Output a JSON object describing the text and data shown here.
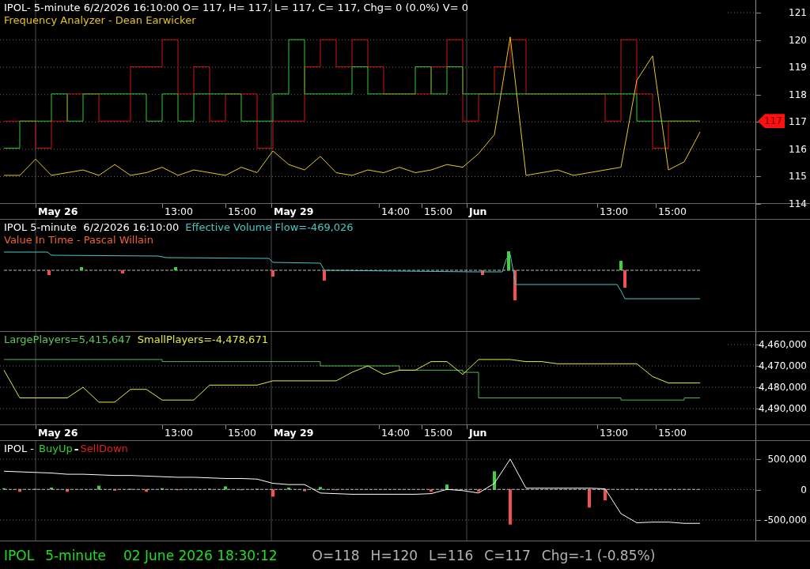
{
  "panels": [
    {
      "kind": "price",
      "legend_lines": [
        [
          {
            "text": "IPOL- 5-minute 6/2/2026 16:10:00 O= 117, H= 117, L= 117, C= 117, Chg= 0 (0.0%) V= 0",
            "color": "#ffffff"
          }
        ],
        [
          {
            "text": "Frequency Analyzer - Dean Earwicker",
            "color": "#e6c21e"
          }
        ]
      ],
      "axis_labels": [
        "121",
        "120",
        "119",
        "118",
        "117",
        "116",
        "115",
        "114"
      ],
      "price_tag": "117"
    },
    {
      "kind": "time_axis",
      "labels": [
        {
          "text": "May 26",
          "kind": "date"
        },
        {
          "text": "13:00",
          "kind": "time"
        },
        {
          "text": "15:00",
          "kind": "time"
        },
        {
          "text": "May 29",
          "kind": "date"
        },
        {
          "text": "14:00",
          "kind": "time"
        },
        {
          "text": "15:00",
          "kind": "time"
        },
        {
          "text": "Jun",
          "kind": "date"
        },
        {
          "text": "13:00",
          "kind": "time"
        },
        {
          "text": "15:00",
          "kind": "time"
        }
      ]
    },
    {
      "kind": "flow",
      "legend_lines": [
        [
          {
            "text": "IPOL 5-minute  6/2/2026 16:10:00",
            "color": "#ffffff"
          },
          {
            "text": "Effective Volume Flow=-469,026",
            "color": "#48c8c0"
          }
        ],
        [
          {
            "text": "Value In Time - Pascal Willain",
            "color": "#e8642c"
          }
        ]
      ]
    },
    {
      "kind": "players",
      "legend_lines": [
        [
          {
            "text": "LargePlayers=5,415,647",
            "color": "#5cc85c"
          },
          {
            "text": "SmallPlayers=-4,478,671",
            "color": "#e8e83c"
          }
        ]
      ],
      "axis_labels": [
        "4,460,000",
        "4,470,000",
        "4,480,000",
        "4,490,000"
      ]
    },
    {
      "kind": "time_axis",
      "labels": [
        {
          "text": "May 26",
          "kind": "date"
        },
        {
          "text": "13:00",
          "kind": "time"
        },
        {
          "text": "15:00",
          "kind": "time"
        },
        {
          "text": "May 29",
          "kind": "date"
        },
        {
          "text": "14:00",
          "kind": "time"
        },
        {
          "text": "15:00",
          "kind": "time"
        },
        {
          "text": "Jun",
          "kind": "date"
        },
        {
          "text": "13:00",
          "kind": "time"
        },
        {
          "text": "15:00",
          "kind": "time"
        }
      ]
    },
    {
      "kind": "buy_sell",
      "legend_lines": [
        [
          {
            "text": "IPOL - ",
            "color": "#ffffff"
          },
          {
            "text": "BuyUp",
            "color": "#30d030"
          },
          {
            "text": "-",
            "color": "#ffffff"
          },
          {
            "text": "SellDown",
            "color": "#e02020"
          }
        ]
      ],
      "axis_labels": [
        "500,000",
        "0",
        "-500,000"
      ]
    }
  ],
  "status_bar": {
    "session": [
      "IPOL",
      "5-minute",
      "02 June 2026 18:30:12"
    ],
    "quote": [
      "O=118",
      "H=120",
      "L=116",
      "C=117",
      "Chg=-1 (-0.85%)"
    ]
  }
}
